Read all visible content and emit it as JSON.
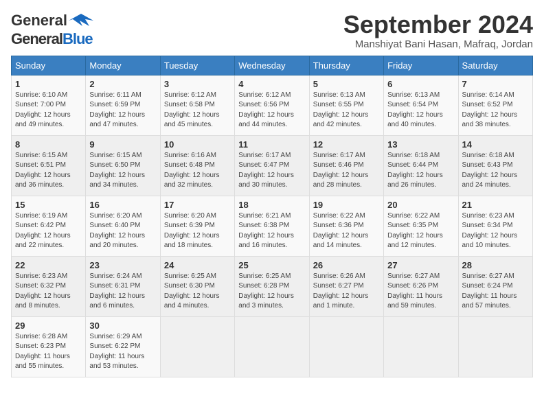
{
  "header": {
    "logo_general": "General",
    "logo_blue": "Blue",
    "month_title": "September 2024",
    "location": "Manshiyat Bani Hasan, Mafraq, Jordan"
  },
  "days_of_week": [
    "Sunday",
    "Monday",
    "Tuesday",
    "Wednesday",
    "Thursday",
    "Friday",
    "Saturday"
  ],
  "weeks": [
    [
      {
        "day": "1",
        "sunrise": "Sunrise: 6:10 AM",
        "sunset": "Sunset: 7:00 PM",
        "daylight": "Daylight: 12 hours and 49 minutes."
      },
      {
        "day": "2",
        "sunrise": "Sunrise: 6:11 AM",
        "sunset": "Sunset: 6:59 PM",
        "daylight": "Daylight: 12 hours and 47 minutes."
      },
      {
        "day": "3",
        "sunrise": "Sunrise: 6:12 AM",
        "sunset": "Sunset: 6:58 PM",
        "daylight": "Daylight: 12 hours and 45 minutes."
      },
      {
        "day": "4",
        "sunrise": "Sunrise: 6:12 AM",
        "sunset": "Sunset: 6:56 PM",
        "daylight": "Daylight: 12 hours and 44 minutes."
      },
      {
        "day": "5",
        "sunrise": "Sunrise: 6:13 AM",
        "sunset": "Sunset: 6:55 PM",
        "daylight": "Daylight: 12 hours and 42 minutes."
      },
      {
        "day": "6",
        "sunrise": "Sunrise: 6:13 AM",
        "sunset": "Sunset: 6:54 PM",
        "daylight": "Daylight: 12 hours and 40 minutes."
      },
      {
        "day": "7",
        "sunrise": "Sunrise: 6:14 AM",
        "sunset": "Sunset: 6:52 PM",
        "daylight": "Daylight: 12 hours and 38 minutes."
      }
    ],
    [
      {
        "day": "8",
        "sunrise": "Sunrise: 6:15 AM",
        "sunset": "Sunset: 6:51 PM",
        "daylight": "Daylight: 12 hours and 36 minutes."
      },
      {
        "day": "9",
        "sunrise": "Sunrise: 6:15 AM",
        "sunset": "Sunset: 6:50 PM",
        "daylight": "Daylight: 12 hours and 34 minutes."
      },
      {
        "day": "10",
        "sunrise": "Sunrise: 6:16 AM",
        "sunset": "Sunset: 6:48 PM",
        "daylight": "Daylight: 12 hours and 32 minutes."
      },
      {
        "day": "11",
        "sunrise": "Sunrise: 6:17 AM",
        "sunset": "Sunset: 6:47 PM",
        "daylight": "Daylight: 12 hours and 30 minutes."
      },
      {
        "day": "12",
        "sunrise": "Sunrise: 6:17 AM",
        "sunset": "Sunset: 6:46 PM",
        "daylight": "Daylight: 12 hours and 28 minutes."
      },
      {
        "day": "13",
        "sunrise": "Sunrise: 6:18 AM",
        "sunset": "Sunset: 6:44 PM",
        "daylight": "Daylight: 12 hours and 26 minutes."
      },
      {
        "day": "14",
        "sunrise": "Sunrise: 6:18 AM",
        "sunset": "Sunset: 6:43 PM",
        "daylight": "Daylight: 12 hours and 24 minutes."
      }
    ],
    [
      {
        "day": "15",
        "sunrise": "Sunrise: 6:19 AM",
        "sunset": "Sunset: 6:42 PM",
        "daylight": "Daylight: 12 hours and 22 minutes."
      },
      {
        "day": "16",
        "sunrise": "Sunrise: 6:20 AM",
        "sunset": "Sunset: 6:40 PM",
        "daylight": "Daylight: 12 hours and 20 minutes."
      },
      {
        "day": "17",
        "sunrise": "Sunrise: 6:20 AM",
        "sunset": "Sunset: 6:39 PM",
        "daylight": "Daylight: 12 hours and 18 minutes."
      },
      {
        "day": "18",
        "sunrise": "Sunrise: 6:21 AM",
        "sunset": "Sunset: 6:38 PM",
        "daylight": "Daylight: 12 hours and 16 minutes."
      },
      {
        "day": "19",
        "sunrise": "Sunrise: 6:22 AM",
        "sunset": "Sunset: 6:36 PM",
        "daylight": "Daylight: 12 hours and 14 minutes."
      },
      {
        "day": "20",
        "sunrise": "Sunrise: 6:22 AM",
        "sunset": "Sunset: 6:35 PM",
        "daylight": "Daylight: 12 hours and 12 minutes."
      },
      {
        "day": "21",
        "sunrise": "Sunrise: 6:23 AM",
        "sunset": "Sunset: 6:34 PM",
        "daylight": "Daylight: 12 hours and 10 minutes."
      }
    ],
    [
      {
        "day": "22",
        "sunrise": "Sunrise: 6:23 AM",
        "sunset": "Sunset: 6:32 PM",
        "daylight": "Daylight: 12 hours and 8 minutes."
      },
      {
        "day": "23",
        "sunrise": "Sunrise: 6:24 AM",
        "sunset": "Sunset: 6:31 PM",
        "daylight": "Daylight: 12 hours and 6 minutes."
      },
      {
        "day": "24",
        "sunrise": "Sunrise: 6:25 AM",
        "sunset": "Sunset: 6:30 PM",
        "daylight": "Daylight: 12 hours and 4 minutes."
      },
      {
        "day": "25",
        "sunrise": "Sunrise: 6:25 AM",
        "sunset": "Sunset: 6:28 PM",
        "daylight": "Daylight: 12 hours and 3 minutes."
      },
      {
        "day": "26",
        "sunrise": "Sunrise: 6:26 AM",
        "sunset": "Sunset: 6:27 PM",
        "daylight": "Daylight: 12 hours and 1 minute."
      },
      {
        "day": "27",
        "sunrise": "Sunrise: 6:27 AM",
        "sunset": "Sunset: 6:26 PM",
        "daylight": "Daylight: 11 hours and 59 minutes."
      },
      {
        "day": "28",
        "sunrise": "Sunrise: 6:27 AM",
        "sunset": "Sunset: 6:24 PM",
        "daylight": "Daylight: 11 hours and 57 minutes."
      }
    ],
    [
      {
        "day": "29",
        "sunrise": "Sunrise: 6:28 AM",
        "sunset": "Sunset: 6:23 PM",
        "daylight": "Daylight: 11 hours and 55 minutes."
      },
      {
        "day": "30",
        "sunrise": "Sunrise: 6:29 AM",
        "sunset": "Sunset: 6:22 PM",
        "daylight": "Daylight: 11 hours and 53 minutes."
      },
      null,
      null,
      null,
      null,
      null
    ]
  ]
}
